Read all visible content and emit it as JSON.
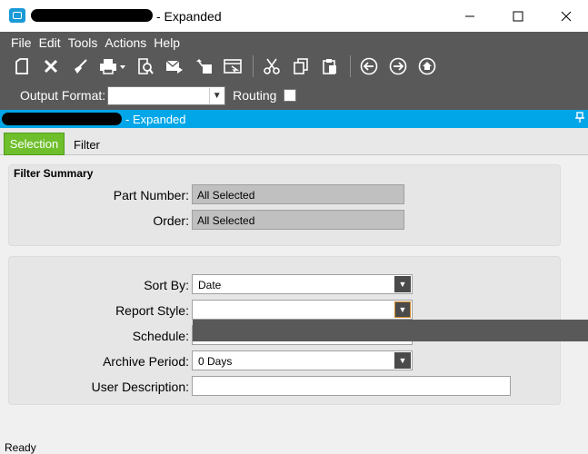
{
  "window": {
    "title_suffix": "- Expanded",
    "minimize_icon": "minimize-icon",
    "maximize_icon": "maximize-icon",
    "close_icon": "close-icon"
  },
  "menu": {
    "items": [
      "File",
      "Edit",
      "Tools",
      "Actions",
      "Help"
    ]
  },
  "toolbar": {
    "icons": [
      "new-icon",
      "delete-icon",
      "clear-icon",
      "print-icon",
      "print-preview-icon",
      "send-icon",
      "attach-icon",
      "generate-icon",
      "cut-icon",
      "copy-icon",
      "paste-icon",
      "back-icon",
      "forward-icon",
      "home-icon"
    ]
  },
  "output_row": {
    "output_format_label": "Output Format:",
    "output_format_value": "",
    "routing_label": "Routing"
  },
  "blue_header": {
    "title_suffix": "- Expanded"
  },
  "tabs": {
    "selection": "Selection",
    "filter": "Filter"
  },
  "filter_summary": {
    "title": "Filter Summary",
    "part_number_label": "Part Number:",
    "part_number_value": "All Selected",
    "order_label": "Order:",
    "order_value": "All Selected"
  },
  "options": {
    "sort_by_label": "Sort By:",
    "sort_by_value": "Date",
    "report_style_label": "Report Style:",
    "report_style_value": "",
    "schedule_label": "Schedule:",
    "archive_period_label": "Archive Period:",
    "archive_period_value": "0 Days",
    "user_description_label": "User Description:",
    "user_description_value": ""
  },
  "status": {
    "text": "Ready"
  }
}
